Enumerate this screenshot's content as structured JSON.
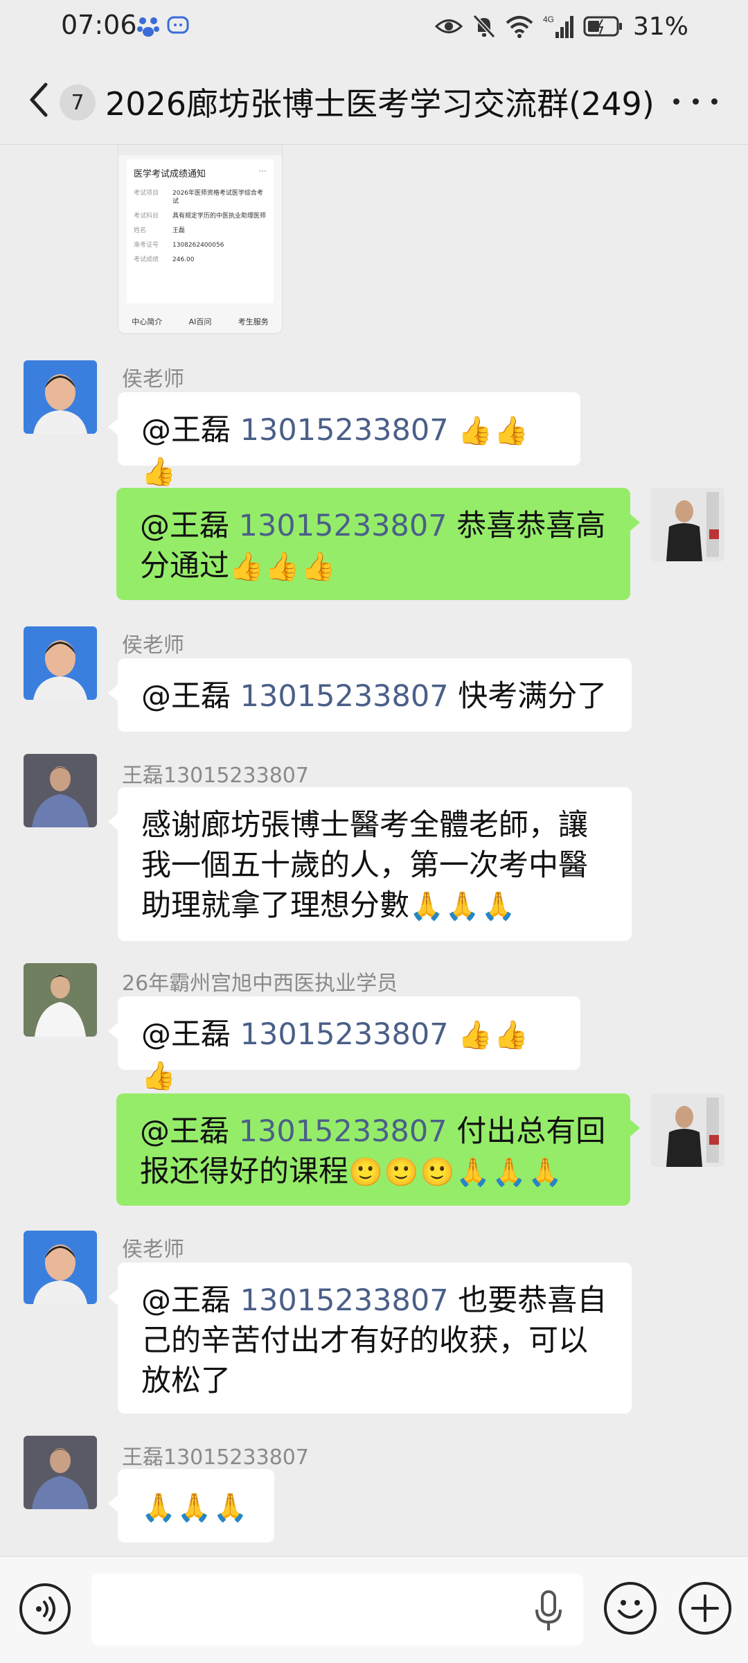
{
  "status_bar": {
    "time": "07:06",
    "battery_percent": "31%",
    "network_label": "4G"
  },
  "header": {
    "unread_count": "7",
    "title": "2026廊坊张博士医考学习交流群(249)"
  },
  "shared_image": {
    "title": "医学考试成绩通知",
    "rows": [
      {
        "k": "考试项目",
        "v": "2026年医师资格考试医学综合考试"
      },
      {
        "k": "考试科目",
        "v": "具有规定学历的中医执业助理医师"
      },
      {
        "k": "姓名",
        "v": "王磊"
      },
      {
        "k": "准考证号",
        "v": "1308262400056"
      },
      {
        "k": "考试成绩",
        "v": "246.00"
      }
    ],
    "tabs": [
      "中心简介",
      "AI百问",
      "考生服务"
    ]
  },
  "messages": [
    {
      "sender": "侯老师",
      "mention": "@王磊",
      "phone": "13015233807",
      "text": "",
      "emoji": "👍👍👍"
    },
    {
      "sender": "",
      "mention": "@王磊",
      "phone": "13015233807",
      "text": "恭喜恭喜高分通过",
      "emoji": "👍👍👍"
    },
    {
      "sender": "侯老师",
      "mention": "@王磊",
      "phone": "13015233807",
      "text": "快考满分了",
      "emoji": ""
    },
    {
      "sender": "王磊13015233807",
      "mention": "",
      "phone": "",
      "text": "感谢廊坊張博士醫考全體老師，讓我一個五十歲的人，第一次考中醫助理就拿了理想分數",
      "emoji": "🙏🙏🙏"
    },
    {
      "sender": "26年霸州宫旭中西医执业学员",
      "mention": "@王磊",
      "phone": "13015233807",
      "text": "",
      "emoji": "👍👍👍"
    },
    {
      "sender": "",
      "mention": "@王磊",
      "phone": "13015233807",
      "text": "付出总有回报还得好的课程",
      "emoji": "🙂🙂🙂🙏🙏🙏"
    },
    {
      "sender": "侯老师",
      "mention": "@王磊",
      "phone": "13015233807",
      "text": "也要恭喜自己的辛苦付出才有好的收获，可以放松了",
      "emoji": ""
    },
    {
      "sender": "王磊13015233807",
      "mention": "",
      "phone": "",
      "text": "",
      "emoji": "🙏🙏🙏"
    }
  ],
  "colors": {
    "background": "#ededed",
    "outgoing_bubble": "#95ec69",
    "incoming_bubble": "#ffffff",
    "mention_phone": "#4a5f88"
  },
  "icons": [
    "back-icon",
    "more-icon",
    "voice-icon",
    "mic-icon",
    "emoji-icon",
    "plus-icon",
    "eye-icon",
    "mute-bell-icon",
    "wifi-icon",
    "signal-icon",
    "battery-icon"
  ]
}
